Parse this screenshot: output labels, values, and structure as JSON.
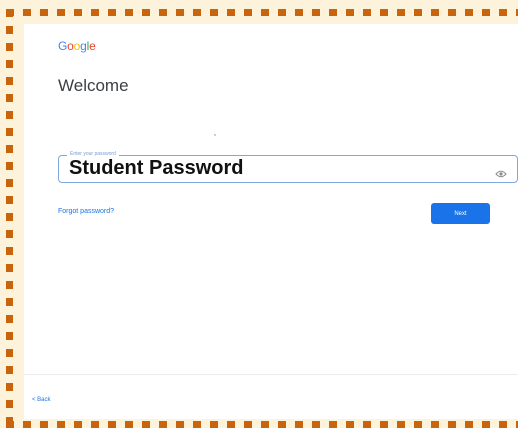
{
  "logo": {
    "letters": [
      {
        "ch": "G",
        "color": "#4285F4"
      },
      {
        "ch": "o",
        "color": "#EA4335"
      },
      {
        "ch": "o",
        "color": "#FBBC05"
      },
      {
        "ch": "g",
        "color": "#4285F4"
      },
      {
        "ch": "l",
        "color": "#34A853"
      },
      {
        "ch": "e",
        "color": "#EA4335"
      }
    ]
  },
  "heading": "Welcome",
  "password": {
    "label": "Enter your password",
    "value": "Student Password",
    "toggle_icon": "eye-icon"
  },
  "links": {
    "forgot": "Forgot password?",
    "back": "< Back"
  },
  "buttons": {
    "next": "Next"
  },
  "colors": {
    "border_dash": "#c9640e",
    "background": "#fdf3da",
    "accent": "#1a73e8"
  }
}
